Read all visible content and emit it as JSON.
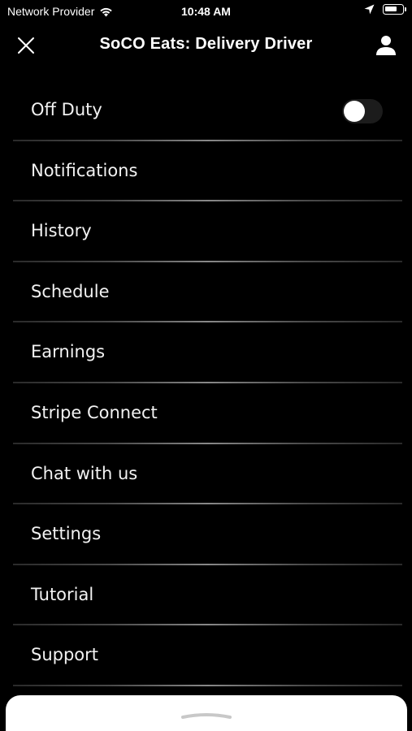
{
  "status_bar": {
    "carrier": "Network Provider",
    "time": "10:48 AM"
  },
  "header": {
    "title": "SoCO Eats: Delivery Driver"
  },
  "menu": {
    "duty_toggle": {
      "label": "Off Duty",
      "on": false
    },
    "items": [
      {
        "label": "Notifications"
      },
      {
        "label": "History"
      },
      {
        "label": "Schedule"
      },
      {
        "label": "Earnings"
      },
      {
        "label": "Stripe Connect"
      },
      {
        "label": "Chat with us"
      },
      {
        "label": "Settings"
      },
      {
        "label": "Tutorial"
      },
      {
        "label": "Support"
      }
    ]
  },
  "icons": {
    "close": "close-icon",
    "profile": "person-icon",
    "wifi": "wifi-icon",
    "location": "location-arrow-icon",
    "battery": "battery-icon"
  }
}
